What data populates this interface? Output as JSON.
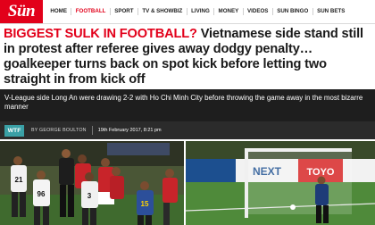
{
  "site": {
    "logo_text": "Sün",
    "brand_color": "#e2001a"
  },
  "nav": {
    "items": [
      {
        "label": "HOME",
        "active": false
      },
      {
        "label": "FOOTBALL",
        "active": true
      },
      {
        "label": "SPORT",
        "active": false
      },
      {
        "label": "TV & SHOWBIZ",
        "active": false
      },
      {
        "label": "LIVING",
        "active": false
      },
      {
        "label": "MONEY",
        "active": false
      },
      {
        "label": "VIDEOS",
        "active": false
      },
      {
        "label": "SUN BINGO",
        "active": false
      },
      {
        "label": "SUN BETS",
        "active": false
      }
    ]
  },
  "article": {
    "kicker": "BIGGEST SULK IN FOOTBALL?",
    "headline": "Vietnamese side stand still in protest after referee gives away dodgy penalty… goalkeeper turns back on spot kick before letting two straight in from kick off",
    "standfirst": "V-League side Long An were drawing 2-2 with Ho Chi Minh City before throwing the game away in the most bizarre manner",
    "section_badge": "WTF",
    "section_color": "#3aa0a6",
    "author": "BY GEORGE BOULTON",
    "date": "19th February 2017, 8:21 pm"
  },
  "images": {
    "left": {
      "shirt_numbers": [
        "21",
        "96",
        "3",
        "15"
      ]
    },
    "right": {
      "hoardings": [
        "NEXT",
        "TOYO"
      ]
    }
  }
}
